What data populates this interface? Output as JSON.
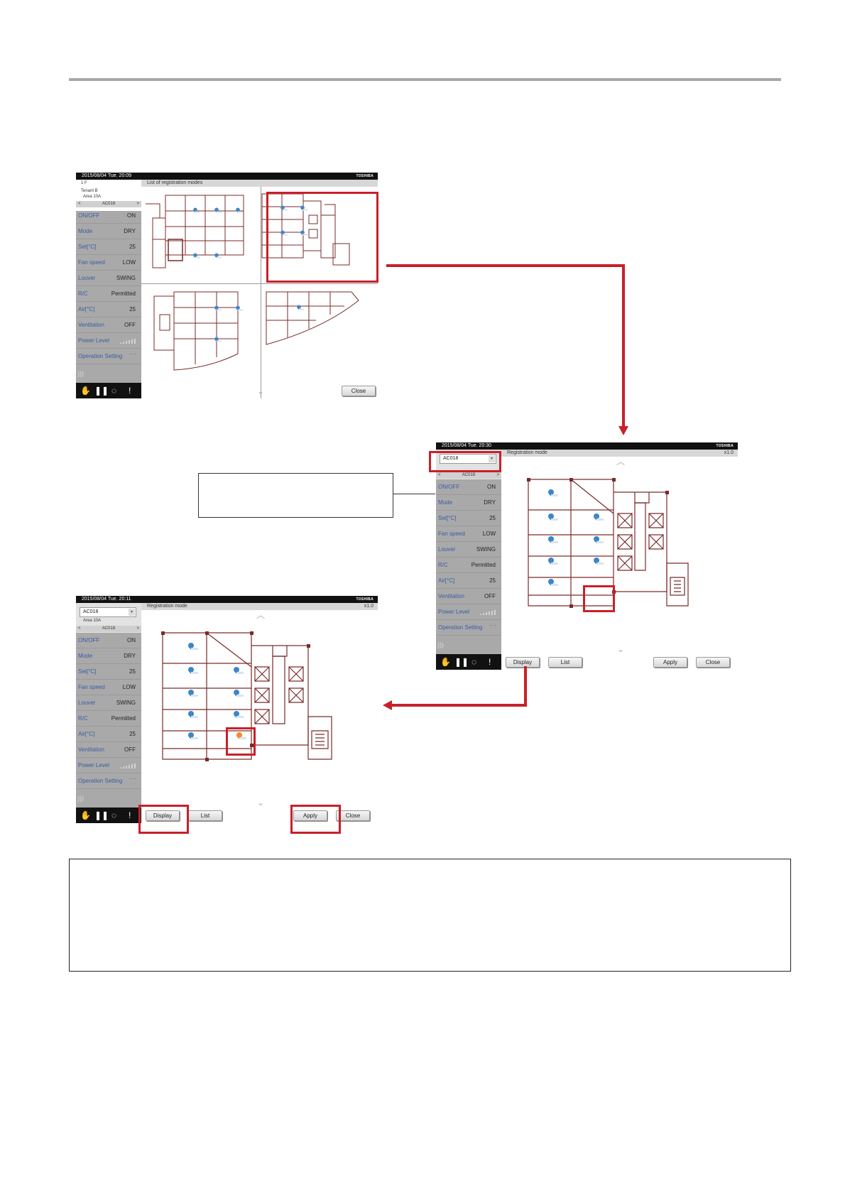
{
  "brand": "TOSHIBA",
  "labels": {
    "on_off": "ON/OFF",
    "mode": "Mode",
    "set_temp": "Set[°C]",
    "fan_speed": "Fan speed",
    "louver": "Louver",
    "rc": "R/C",
    "air_temp": "Air[°C]",
    "ventilation": "Ventilation",
    "power_level": "Power Level",
    "operation_setting": "Operation Setting"
  },
  "values": {
    "on_off": "ON",
    "mode": "DRY",
    "set_temp": "25",
    "fan_speed": "LOW",
    "louver": "SWING",
    "rc": "Permitted",
    "air_temp": "25",
    "ventilation": "OFF",
    "operation_setting": "···"
  },
  "nav": {
    "prev": "<",
    "next": ">"
  },
  "screen1": {
    "datetime": "2015/08/04  Tue.  20:09",
    "title": "List of registration modes",
    "floor": "1 F",
    "tenant": "Tenant B",
    "area": "Area 10A",
    "device": "AC018",
    "close": "Close"
  },
  "screen2": {
    "datetime": "2015/08/04  Tue.  20:30",
    "title": "Registration mode",
    "zoom": "x1.0",
    "device_select": "AC018",
    "device": "AC018",
    "display": "Display",
    "list": "List",
    "apply": "Apply",
    "close": "Close"
  },
  "screen3": {
    "datetime": "2015/08/04  Tue.  20:11",
    "title": "Registration mode",
    "zoom": "x1.0",
    "device_select": "AC018",
    "area": "Area 10A",
    "device": "AC018",
    "display": "Display",
    "list": "List",
    "apply": "Apply",
    "close": "Close"
  },
  "icons": {
    "hand": "hand-icon",
    "grid": "grid-view-icon",
    "circle": "refresh-icon",
    "alert": "alert-icon",
    "signal": "signal-icon",
    "chevron_up": "chevron-up-icon",
    "chevron_down": "chevron-down-icon"
  },
  "colors": {
    "highlight": "#c8202a",
    "pin": "#3b86c8",
    "pin_selected": "#f08a2c",
    "plan": "#7a2a2a"
  }
}
